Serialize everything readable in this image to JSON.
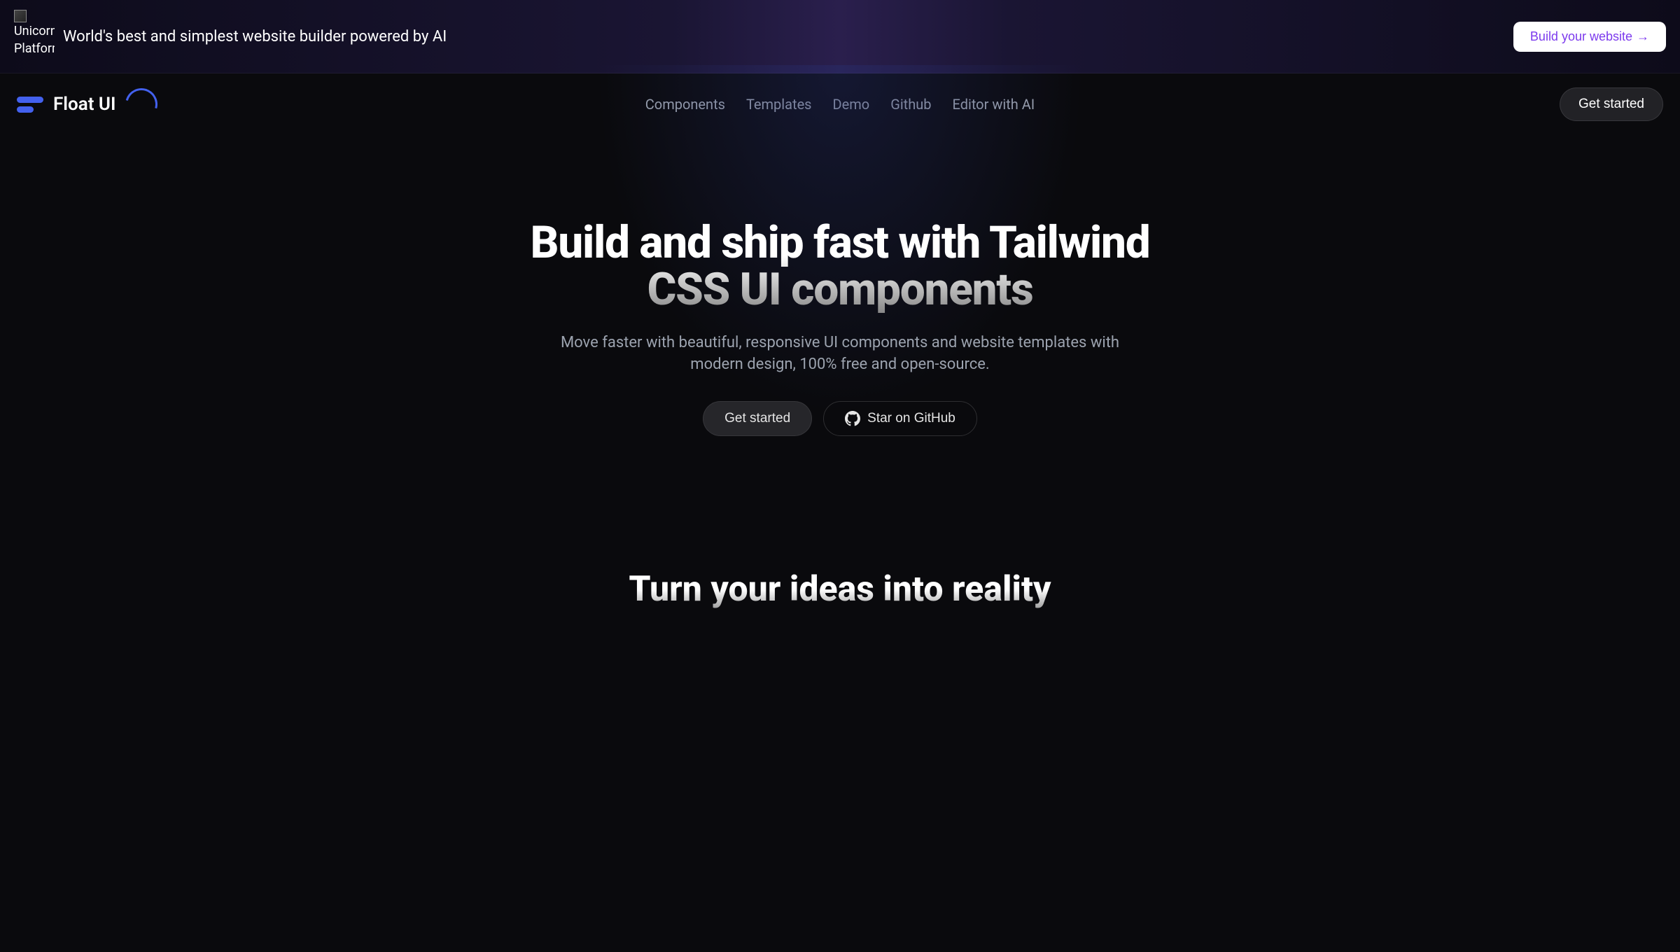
{
  "banner": {
    "logo_alt": "Unicorn Platform",
    "text": "World's best and simplest website builder powered by AI",
    "cta_label": "Build your website",
    "cta_arrow": "→"
  },
  "nav": {
    "brand": "Float UI",
    "links": [
      "Components",
      "Templates",
      "Demo",
      "Github",
      "Editor with AI"
    ],
    "cta_label": "Get started"
  },
  "hero": {
    "title": "Build and ship fast with Tailwind CSS UI components",
    "subtitle": "Move faster with beautiful, responsive UI components and website templates with modern design, 100% free and open-source.",
    "primary_label": "Get started",
    "secondary_label": "Star on GitHub"
  },
  "section2": {
    "title": "Turn your ideas into reality"
  }
}
